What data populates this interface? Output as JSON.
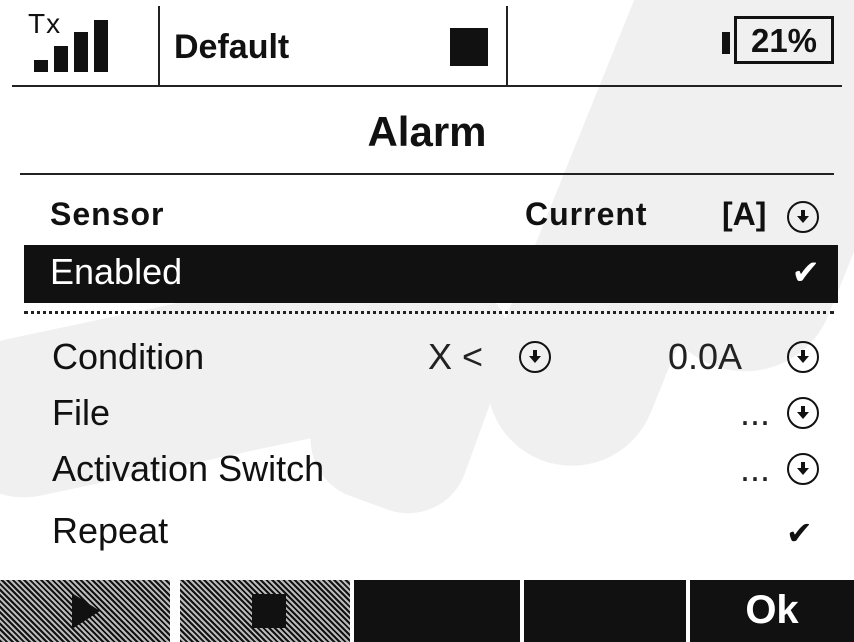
{
  "status": {
    "tx_label": "Tx",
    "profile": "Default",
    "battery_percent": "21%",
    "signal_bars": 4
  },
  "title": "Alarm",
  "sensor": {
    "label": "Sensor",
    "value": "Current",
    "unit": "[A]"
  },
  "enabled": {
    "label": "Enabled",
    "checked": true
  },
  "settings": {
    "condition": {
      "label": "Condition",
      "operator": "X <",
      "value": "0.0A"
    },
    "file": {
      "label": "File",
      "value": "..."
    },
    "activation_switch": {
      "label": "Activation Switch",
      "value": "..."
    },
    "repeat": {
      "label": "Repeat",
      "checked": true
    }
  },
  "bottom_bar": {
    "ok_label": "Ok",
    "buttons": [
      "play",
      "stop",
      "",
      "",
      "Ok"
    ]
  },
  "icons": {
    "dropdown": "circle-down-arrow-icon",
    "check": "checkmark-icon",
    "play": "play-icon",
    "stop": "stop-icon"
  },
  "colors": {
    "foreground": "#111111",
    "background": "#ffffff",
    "highlight": "#111111",
    "highlight_text": "#ffffff"
  }
}
